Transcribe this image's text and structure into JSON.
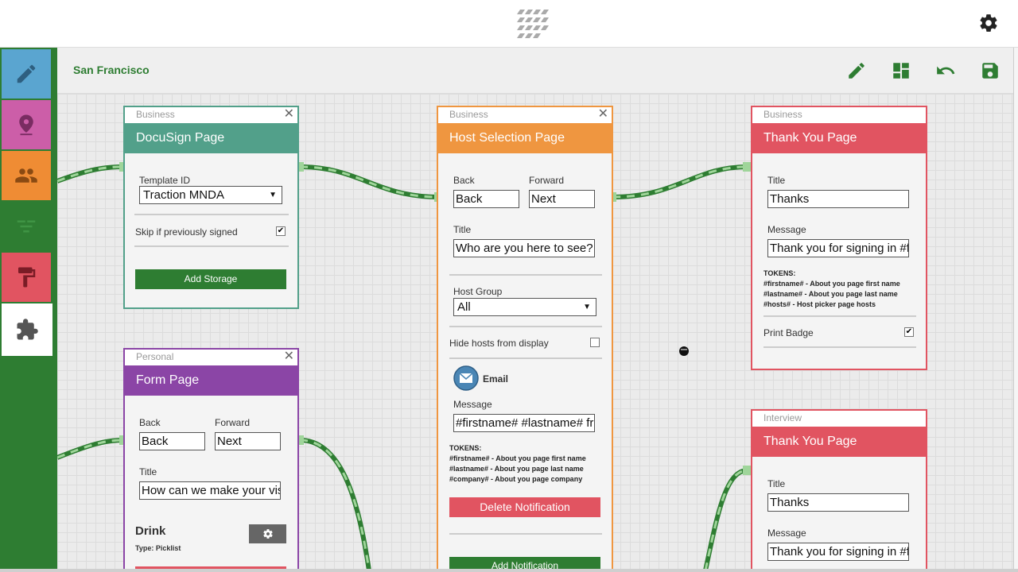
{
  "header": {
    "logo": "app-logo",
    "settings_icon": "gear-icon"
  },
  "sidebar": {
    "tabs": [
      {
        "name": "edit",
        "icon": "pencil-icon",
        "color": "#5aa5d0"
      },
      {
        "name": "location",
        "icon": "map-pin-icon",
        "color": "#cc5ea8"
      },
      {
        "name": "people",
        "icon": "people-icon",
        "color": "#ef8c34"
      },
      {
        "name": "flow",
        "icon": "flow-icon",
        "color": "#2e7d32"
      },
      {
        "name": "paint",
        "icon": "paint-roller-icon",
        "color": "#e15461"
      },
      {
        "name": "plugins",
        "icon": "puzzle-icon",
        "color": "#ffffff"
      }
    ]
  },
  "toolbar": {
    "location": "San Francisco",
    "tools": [
      "pencil-icon",
      "dashboard-icon",
      "undo-icon",
      "save-icon"
    ]
  },
  "cards": {
    "docusign": {
      "category": "Business",
      "title": "DocuSign Page",
      "color": "#52a08a",
      "template_label": "Template ID",
      "template_value": "Traction MNDA",
      "skip_label": "Skip if previously signed",
      "skip_checked": "✔",
      "add_storage": "Add Storage"
    },
    "host": {
      "category": "Business",
      "title": "Host Selection Page",
      "color": "#ef9640",
      "back_label": "Back",
      "back_value": "Back",
      "forward_label": "Forward",
      "forward_value": "Next",
      "title_label": "Title",
      "title_value": "Who are you here to see?",
      "group_label": "Host Group",
      "group_value": "All",
      "hide_label": "Hide hosts from display",
      "email_label": "Email",
      "message_label": "Message",
      "message_value": "#firstname# #lastname# from",
      "tokens_head": "TOKENS:",
      "tokens": [
        "#firstname# - About you page first name",
        "#lastname# - About you page last name",
        "#company# - About you page company"
      ],
      "delete_notification": "Delete Notification",
      "add_notification": "Add Notification"
    },
    "thanks1": {
      "category": "Business",
      "title": "Thank You Page",
      "color": "#e15461",
      "title_label": "Title",
      "title_value": "Thanks",
      "message_label": "Message",
      "message_value": "Thank you for signing in #firstname#",
      "tokens_head": "TOKENS:",
      "tokens": [
        "#firstname# - About you page first name",
        "#lastname# - About you page last name",
        "#hosts# - Host picker page hosts"
      ],
      "badge_label": "Print Badge",
      "badge_checked": "✔"
    },
    "form": {
      "category": "Personal",
      "title": "Form Page",
      "color": "#8b45a6",
      "back_label": "Back",
      "back_value": "Back",
      "forward_label": "Forward",
      "forward_value": "Next",
      "title_label": "Title",
      "title_value": "How can we make your visit",
      "field_name": "Drink",
      "field_type": "Type: Picklist"
    },
    "thanks2": {
      "category": "Interview",
      "title": "Thank You Page",
      "color": "#e15461",
      "title_label": "Title",
      "title_value": "Thanks",
      "message_label": "Message",
      "message_value": "Thank you for signing in #firstname#"
    }
  }
}
